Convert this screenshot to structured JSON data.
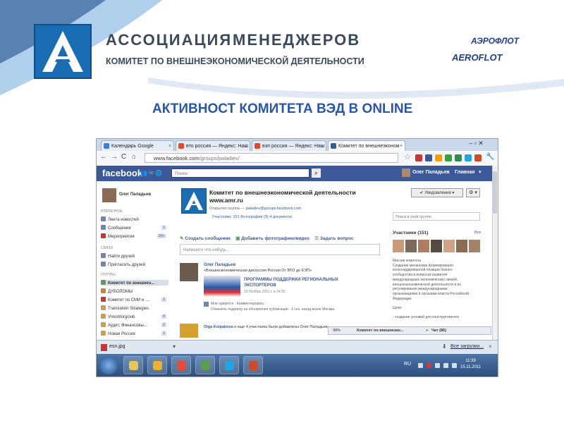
{
  "header": {
    "title_part1": "АССОЦИАЦИЯ",
    "title_part2": "МЕНЕДЖЕРОВ",
    "subtitle": "КОМИТЕТ ПО ВНЕШНЕЭКОНОМИЧЕСКОЙ ДЕЯТЕЛЬНОСТИ",
    "sponsor_ru": "АЭРОФЛОТ",
    "sponsor_en": "AEROFLOT",
    "slide_title": "АКТИВНОСТ КОМИТЕТА ВЭД  В ONLINE"
  },
  "browser": {
    "tabs": [
      {
        "label": "Календарь Google",
        "color": "#3d7de2"
      },
      {
        "label": "вто россия — Яндекс: Наш",
        "color": "#e04a2a"
      },
      {
        "label": "вэп россия — Яндекс: Наш",
        "color": "#e04a2a"
      },
      {
        "label": "Комитет по внешнеэконом",
        "color": "#3b5998"
      }
    ],
    "url_host": "www.facebook.com",
    "url_path": "/groups/paladiev/",
    "nav_icons": [
      "back-icon",
      "forward-icon",
      "reload-icon",
      "home-icon"
    ]
  },
  "facebook": {
    "logo": "facebook",
    "search_placeholder": "Поиск",
    "user_name": "Олег Паладьев",
    "home_label": "Главная",
    "left": {
      "user": "Олег Паладьев",
      "section_favorites": "ИЗБРАННОЕ",
      "favorites": [
        {
          "label": "Лента новостей",
          "count": ""
        },
        {
          "label": "Сообщения",
          "count": "1"
        },
        {
          "label": "Мероприятия",
          "count": "20+"
        }
      ],
      "section_links": "СВЯЗИ",
      "links": [
        {
          "label": "Найти друзей"
        },
        {
          "label": "Пригласить друзей"
        }
      ],
      "section_groups": "ГРУППЫ",
      "groups": [
        {
          "label": "Комитет по внешнеэ...",
          "count": ""
        },
        {
          "label": "ДУБОЛОМЫ",
          "count": ""
        },
        {
          "label": "Комитет по СМИ и ...",
          "count": "1"
        },
        {
          "label": "Translation Strategies",
          "count": ""
        },
        {
          "label": "Vneshtorgclub",
          "count": "4"
        },
        {
          "label": "Аудит, Финансовы...",
          "count": "2"
        },
        {
          "label": "Новая Россия",
          "count": "1"
        }
      ]
    },
    "group": {
      "name_line1": "Комитет по внешнеэкономической деятельности",
      "name_line2": "www.amr.ru",
      "meta_prefix": "Открытая группа —",
      "email": "paladiev@groups.facebook.com",
      "tabs": "Участники: 151   Фотографии (9)   4 документа",
      "notify_button": "✔ Уведомления ▾",
      "settings_button": "⚙ ▾",
      "search_placeholder": "Поиск в этой группе",
      "actions": [
        "Создать сообщение",
        "Добавить фотографию/видео",
        "Задать вопрос"
      ],
      "composer_placeholder": "Напишите что-нибудь..."
    },
    "post": {
      "author": "Олег Паладьев",
      "text": "«Внешнеэкономическая дискуссия России От ВТО до ЕЭП»",
      "link_title": "ПРОГРАММЫ ПОДДЕРЖКИ РЕГИОНАЛЬНЫХ ЭКСПОРТЕРОВ",
      "date": "15 Ноябрь 2011 г. в 14:30",
      "like_line": "Мне нравится · Комментировать ·",
      "unsubscribe_line": "Отменить подписку на обновления публикации · 2 сек. назад возле Москва"
    },
    "post2": {
      "author": "Olga Kolpakova",
      "text": "и еще 4 участника были добавлены Олег Паладьев"
    },
    "members": {
      "title": "Участники (151)",
      "all_link": "Все",
      "face_colors": [
        "#c99a7a",
        "#7a6a5e",
        "#b07d62",
        "#564a40",
        "#d0a385",
        "#8b6b56",
        "#a4826a"
      ]
    },
    "description": [
      "Миссия комитета",
      "Создание механизма формирования",
      "консолидированной позиции бизнес-",
      "сообщества в вопросах развития",
      "международных экономических связей,",
      "внешнеэкономической деятельности и их",
      "регулирования международными",
      "организациями и органами власти Российской",
      "Федерации.",
      "",
      "Цели:",
      "",
      "- создание условий для конструктивного"
    ],
    "chatbar": {
      "percent": "98%",
      "group": "Комитет по внешнеэко...",
      "chat": "Чат (86)"
    }
  },
  "download_bar": {
    "file": "esn.jpg",
    "all_downloads": "Все загрузки..."
  },
  "taskbar": {
    "language": "RU",
    "time": "11:39",
    "date": "15.11.2011",
    "apps": [
      {
        "name": "explorer",
        "color": "#e8c65a"
      },
      {
        "name": "mail",
        "color": "#f0b030"
      },
      {
        "name": "chrome",
        "color": "#e84a3a"
      },
      {
        "name": "evernote",
        "color": "#5aa04a"
      },
      {
        "name": "skype",
        "color": "#1fa6e0"
      },
      {
        "name": "powerpoint",
        "color": "#d2492a"
      }
    ]
  }
}
